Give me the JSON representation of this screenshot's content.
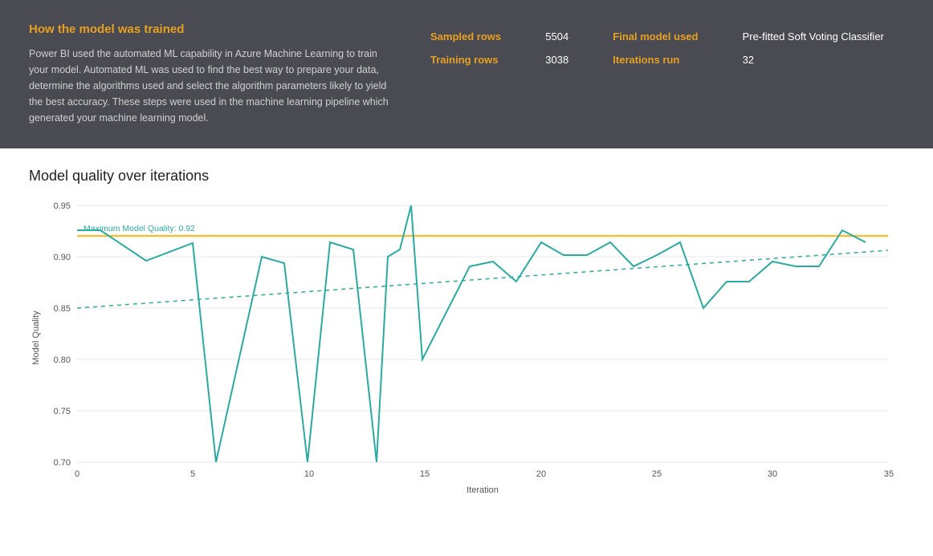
{
  "top": {
    "title": "How the model was trained",
    "description": "Power BI used the automated ML capability in Azure Machine Learning to train your model. Automated ML was used to find the best way to prepare your data, determine the algorithms used and select the algorithm parameters likely to yield the best accuracy. These steps were used in the machine learning pipeline which generated your machine learning model.",
    "stats": {
      "sampled_rows_label": "Sampled rows",
      "sampled_rows_value": "5504",
      "training_rows_label": "Training rows",
      "training_rows_value": "3038",
      "final_model_label": "Final model used",
      "final_model_value": "Pre-fitted Soft Voting Classifier",
      "iterations_label": "Iterations run",
      "iterations_value": "32"
    }
  },
  "chart": {
    "title": "Model quality over iterations",
    "y_label": "Model Quality",
    "x_label": "Iteration",
    "max_quality_label": "Maximum Model Quality: 0.92"
  }
}
